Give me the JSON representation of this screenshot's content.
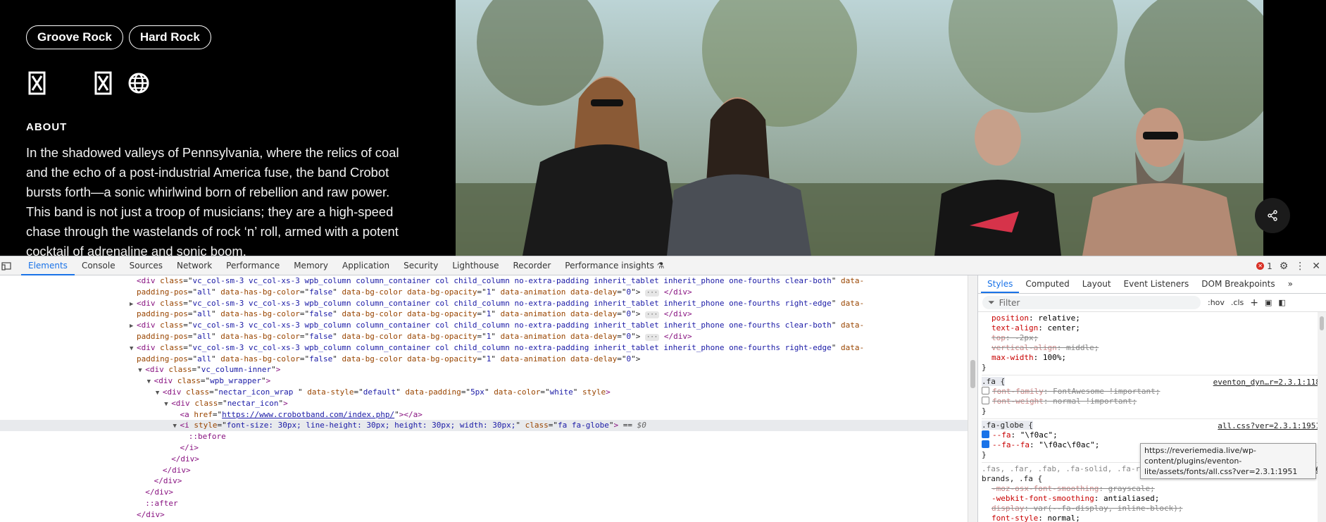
{
  "page": {
    "tags": [
      "Groove Rock",
      "Hard Rock"
    ],
    "socials": [
      "x-twitter-icon",
      "x-twitter-icon",
      "globe-icon"
    ],
    "about_heading": "ABOUT",
    "about_text": "In the shadowed valleys of Pennsylvania, where the relics of coal and the echo of a post-industrial America fuse, the band Crobot bursts forth—a sonic whirlwind born of rebellion and raw power. This band is not just a troop of musicians; they are a high-speed chase through the wastelands of rock ‘n’ roll, armed with a potent cocktail of adrenaline and sonic boom."
  },
  "devtools": {
    "tabs": [
      "Elements",
      "Console",
      "Sources",
      "Network",
      "Performance",
      "Memory",
      "Application",
      "Security",
      "Lighthouse",
      "Recorder",
      "Performance insights"
    ],
    "active_tab": "Elements",
    "error_count": "1",
    "dom_lines": [
      {
        "indent": 3,
        "tri": "",
        "cls": "",
        "html": "<span class=\"tagc\">&lt;div </span><span class=\"attr\">class</span>=\"<span class=\"val\">vc_col-sm-3 vc_col-xs-3 wpb_column column_container col child_column no-extra-padding inherit_tablet inherit_phone one-fourths clear-both</span>\" <span class=\"attr\">data-</span>"
      },
      {
        "indent": 3,
        "tri": "",
        "cls": "",
        "html": "<span class=\"attr\">padding-pos</span>=\"<span class=\"val\">all</span>\" <span class=\"attr\">data-has-bg-color</span>=\"<span class=\"val\">false</span>\" <span class=\"attr\">data-bg-color</span> <span class=\"attr\">data-bg-opacity</span>=\"<span class=\"val\">1</span>\" <span class=\"attr\">data-animation</span> <span class=\"attr\">data-delay</span>=\"<span class=\"val\">0</span>\"&gt; <span class=\"ell\">···</span> <span class=\"tagc\">&lt;/div&gt;</span>"
      },
      {
        "indent": 3,
        "tri": "▶",
        "cls": "",
        "html": "<span class=\"tagc\">&lt;div </span><span class=\"attr\">class</span>=\"<span class=\"val\">vc_col-sm-3 vc_col-xs-3 wpb_column column_container col child_column no-extra-padding inherit_tablet inherit_phone one-fourths right-edge</span>\" <span class=\"attr\">data-</span>"
      },
      {
        "indent": 3,
        "tri": "",
        "cls": "",
        "html": "<span class=\"attr\">padding-pos</span>=\"<span class=\"val\">all</span>\" <span class=\"attr\">data-has-bg-color</span>=\"<span class=\"val\">false</span>\" <span class=\"attr\">data-bg-color</span> <span class=\"attr\">data-bg-opacity</span>=\"<span class=\"val\">1</span>\" <span class=\"attr\">data-animation</span> <span class=\"attr\">data-delay</span>=\"<span class=\"val\">0</span>\"&gt; <span class=\"ell\">···</span> <span class=\"tagc\">&lt;/div&gt;</span>"
      },
      {
        "indent": 3,
        "tri": "▶",
        "cls": "",
        "html": "<span class=\"tagc\">&lt;div </span><span class=\"attr\">class</span>=\"<span class=\"val\">vc_col-sm-3 vc_col-xs-3 wpb_column column_container col child_column no-extra-padding inherit_tablet inherit_phone one-fourths clear-both</span>\" <span class=\"attr\">data-</span>"
      },
      {
        "indent": 3,
        "tri": "",
        "cls": "",
        "html": "<span class=\"attr\">padding-pos</span>=\"<span class=\"val\">all</span>\" <span class=\"attr\">data-has-bg-color</span>=\"<span class=\"val\">false</span>\" <span class=\"attr\">data-bg-color</span> <span class=\"attr\">data-bg-opacity</span>=\"<span class=\"val\">1</span>\" <span class=\"attr\">data-animation</span> <span class=\"attr\">data-delay</span>=\"<span class=\"val\">0</span>\"&gt; <span class=\"ell\">···</span> <span class=\"tagc\">&lt;/div&gt;</span>"
      },
      {
        "indent": 3,
        "tri": "▼",
        "cls": "",
        "html": "<span class=\"tagc\">&lt;div </span><span class=\"attr\">class</span>=\"<span class=\"val\">vc_col-sm-3 vc_col-xs-3 wpb_column column_container col child_column no-extra-padding inherit_tablet inherit_phone one-fourths right-edge</span>\" <span class=\"attr\">data-</span>"
      },
      {
        "indent": 3,
        "tri": "",
        "cls": "",
        "html": "<span class=\"attr\">padding-pos</span>=\"<span class=\"val\">all</span>\" <span class=\"attr\">data-has-bg-color</span>=\"<span class=\"val\">false</span>\" <span class=\"attr\">data-bg-color</span> <span class=\"attr\">data-bg-opacity</span>=\"<span class=\"val\">1</span>\" <span class=\"attr\">data-animation</span> <span class=\"attr\">data-delay</span>=\"<span class=\"val\">0</span>\"&gt;"
      },
      {
        "indent": 4,
        "tri": "▼",
        "cls": "",
        "html": "<span class=\"tagc\">&lt;div </span><span class=\"attr\">class</span>=\"<span class=\"val\">vc_column-inner</span>\"<span class=\"tagc\">&gt;</span>"
      },
      {
        "indent": 5,
        "tri": "▼",
        "cls": "",
        "html": "<span class=\"tagc\">&lt;div </span><span class=\"attr\">class</span>=\"<span class=\"val\">wpb_wrapper</span>\"<span class=\"tagc\">&gt;</span>"
      },
      {
        "indent": 6,
        "tri": "▼",
        "cls": "",
        "html": "<span class=\"tagc\">&lt;div </span><span class=\"attr\">class</span>=\"<span class=\"val\">nectar_icon_wrap </span>\" <span class=\"attr\">data-style</span>=\"<span class=\"val\">default</span>\" <span class=\"attr\">data-padding</span>=\"<span class=\"val\">5px</span>\" <span class=\"attr\">data-color</span>=\"<span class=\"val\">white</span>\" <span class=\"attr\">style</span><span class=\"tagc\">&gt;</span>"
      },
      {
        "indent": 7,
        "tri": "▼",
        "cls": "",
        "html": "<span class=\"tagc\">&lt;div </span><span class=\"attr\">class</span>=\"<span class=\"val\">nectar_icon</span>\"<span class=\"tagc\">&gt;</span>"
      },
      {
        "indent": 8,
        "tri": "",
        "cls": "",
        "html": "<span class=\"tagc\">&lt;a </span><span class=\"attr\">href</span>=\"<span class=\"link\">https://www.crobotband.com/index.php/</span>\"<span class=\"tagc\">&gt;&lt;/a&gt;</span>"
      },
      {
        "indent": 8,
        "tri": "▼",
        "cls": "selected",
        "html": "<span class=\"tagc\">&lt;i </span><span class=\"attr\">style</span>=\"<span class=\"val\">font-size: 30px; line-height: 30px; height: 30px; width: 30px;</span>\" <span class=\"attr\">class</span>=\"<span class=\"val\">fa fa-globe</span>\"<span class=\"tagc\">&gt;</span> == <span class=\"dollar\">$0</span>"
      },
      {
        "indent": 9,
        "tri": "",
        "cls": "",
        "html": "<span class=\"pseudo\">::before</span>"
      },
      {
        "indent": 8,
        "tri": "",
        "cls": "",
        "html": "<span class=\"tagc\">&lt;/i&gt;</span>"
      },
      {
        "indent": 7,
        "tri": "",
        "cls": "",
        "html": "<span class=\"tagc\">&lt;/div&gt;</span>"
      },
      {
        "indent": 6,
        "tri": "",
        "cls": "",
        "html": "<span class=\"tagc\">&lt;/div&gt;</span>"
      },
      {
        "indent": 5,
        "tri": "",
        "cls": "",
        "html": "<span class=\"tagc\">&lt;/div&gt;</span>"
      },
      {
        "indent": 4,
        "tri": "",
        "cls": "",
        "html": "<span class=\"tagc\">&lt;/div&gt;</span>"
      },
      {
        "indent": 4,
        "tri": "",
        "cls": "",
        "html": "<span class=\"pseudo\">::after</span>"
      },
      {
        "indent": 3,
        "tri": "",
        "cls": "",
        "html": "<span class=\"tagc\">&lt;/div&gt;</span>"
      },
      {
        "indent": 3,
        "tri": "",
        "cls": "",
        "html": "<span class=\"pseudo\">::after</span>"
      }
    ],
    "styles_tabs": [
      "Styles",
      "Computed",
      "Layout",
      "Event Listeners",
      "DOM Breakpoints"
    ],
    "filter_placeholder": "Filter",
    "hov": ":hov",
    "cls": ".cls",
    "tooltip": "https://reveriemedia.live/wp-content/plugins/eventon-lite/assets/fonts/all.css?ver=2.3.1:1951"
  }
}
